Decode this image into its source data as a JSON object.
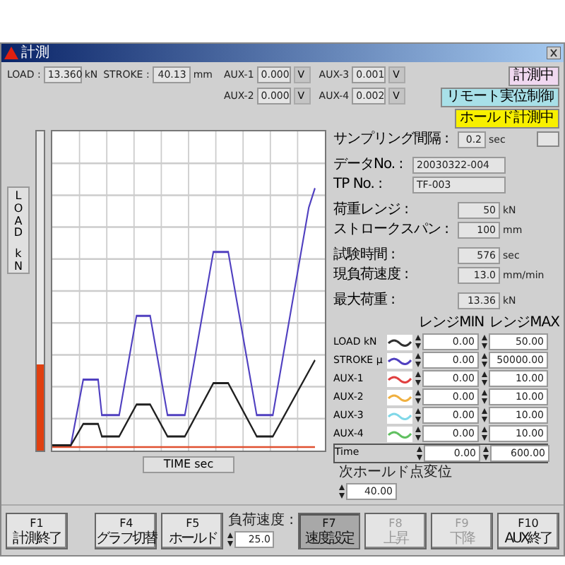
{
  "window": {
    "title": "計測"
  },
  "readings": [
    {
      "label": "LOAD :",
      "value": "13.360",
      "unit": "kN"
    },
    {
      "label": "STROKE :",
      "value": "40.13",
      "unit": "mm"
    }
  ],
  "aux": [
    {
      "label": "AUX-1",
      "value": "0.000",
      "unit": "V"
    },
    {
      "label": "AUX-2",
      "value": "0.000",
      "unit": "V"
    },
    {
      "label": "AUX-3",
      "value": "0.001",
      "unit": "V"
    },
    {
      "label": "AUX-4",
      "value": "0.002",
      "unit": "V"
    }
  ],
  "status": [
    {
      "label": "計測中",
      "color": "#f0d8f0"
    },
    {
      "label": "リモート実位制御",
      "color": "#a8e0e8"
    },
    {
      "label": "ホールド計測中",
      "color": "#f8f000"
    }
  ],
  "graph": {
    "y_axis": {
      "name": "LOAD",
      "unit": "kN"
    },
    "x_axis": "TIME sec",
    "load_bar": {
      "level": 0.27
    }
  },
  "sampling": {
    "label": "サンプリング間隔 :",
    "value": "0.2",
    "unit": "sec"
  },
  "info": [
    {
      "label": "データNo. :",
      "value": "20030322-004"
    },
    {
      "label": "TP No. :",
      "value": "TF-003"
    }
  ],
  "groups": [
    [
      {
        "label": "荷重レンジ :",
        "value": "50",
        "unit": "kN"
      },
      {
        "label": "ストロークスパン :",
        "value": "100",
        "unit": "mm"
      }
    ],
    [
      {
        "label": "試験時間 :",
        "value": "576",
        "unit": "sec"
      },
      {
        "label": "現負荷速度 :",
        "value": "13.0",
        "unit": "mm/min"
      }
    ],
    [
      {
        "label": "最大荷重 :",
        "value": "13.36",
        "unit": "kN"
      }
    ]
  ],
  "channel_table": {
    "columns": [
      "レンジMIN",
      "レンジMAX"
    ],
    "rows": [
      {
        "kind": "signal",
        "name": "LOAD kN",
        "color": "#303030",
        "min": "0.00",
        "max": "50.00"
      },
      {
        "kind": "signal",
        "name": "STROKE μ",
        "color": "#5040c0",
        "min": "0.00",
        "max": "50000.00"
      },
      {
        "kind": "signal",
        "name": "AUX-1",
        "color": "#e04040",
        "min": "0.00",
        "max": "10.00"
      },
      {
        "kind": "signal",
        "name": "AUX-2",
        "color": "#f0b040",
        "min": "0.00",
        "max": "10.00"
      },
      {
        "kind": "signal",
        "name": "AUX-3",
        "color": "#80d8e8",
        "min": "0.00",
        "max": "10.00"
      },
      {
        "kind": "signal",
        "name": "AUX-4",
        "color": "#60c060",
        "min": "0.00",
        "max": "10.00"
      },
      {
        "kind": "time",
        "name": "Time",
        "min": "0.00",
        "max": "600.00"
      }
    ]
  },
  "next_hold": {
    "label": "次ホールド点変位",
    "value": "40.00"
  },
  "function_keys_left": [
    {
      "kind": "key",
      "key": "F1",
      "label": "計測終了",
      "selected": false,
      "disabled": false
    }
  ],
  "function_keys": [
    {
      "kind": "key",
      "key": "F4",
      "label": "グラフ切替",
      "selected": false,
      "disabled": false
    },
    {
      "kind": "key",
      "key": "F5",
      "label": "ホールド",
      "selected": false,
      "disabled": false
    },
    {
      "kind": "speed",
      "label": "負荷速度 :",
      "value": "25.0"
    },
    {
      "kind": "key",
      "key": "F7",
      "label": "速度設定",
      "selected": true,
      "disabled": false
    },
    {
      "kind": "key",
      "key": "F8",
      "label": "上昇",
      "selected": false,
      "disabled": true
    },
    {
      "kind": "key",
      "key": "F9",
      "label": "下降",
      "selected": false,
      "disabled": true
    },
    {
      "kind": "key",
      "key": "F10",
      "label": "AUX終了",
      "selected": false,
      "disabled": false
    }
  ]
}
